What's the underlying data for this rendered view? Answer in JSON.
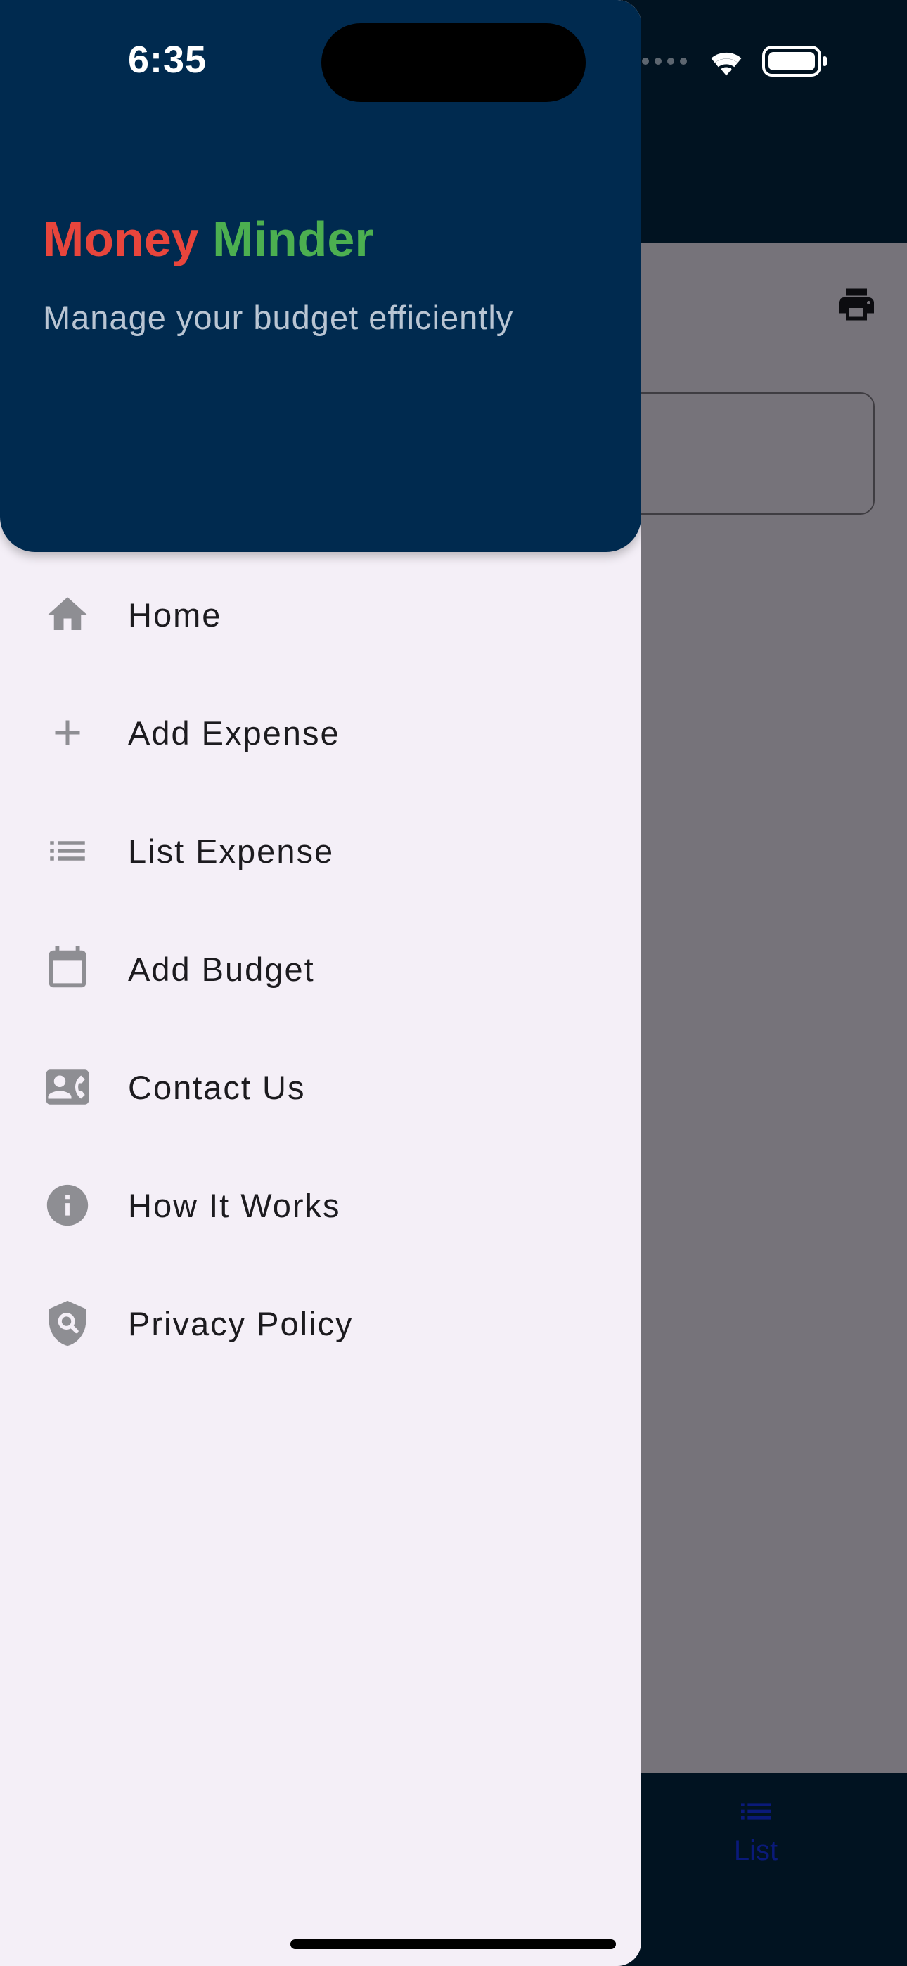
{
  "status_bar": {
    "time": "6:35"
  },
  "drawer": {
    "title_word_1": "Money",
    "title_word_2": "Minder",
    "subtitle": "Manage your budget efficiently",
    "items": [
      {
        "label": "Home",
        "icon": "home-icon"
      },
      {
        "label": "Add Expense",
        "icon": "plus-icon"
      },
      {
        "label": "List Expense",
        "icon": "list-icon"
      },
      {
        "label": "Add Budget",
        "icon": "calendar-icon"
      },
      {
        "label": "Contact Us",
        "icon": "contact-card-icon"
      },
      {
        "label": "How It Works",
        "icon": "info-icon"
      },
      {
        "label": "Privacy Policy",
        "icon": "privacy-shield-icon"
      }
    ]
  },
  "app": {
    "bottom_nav": {
      "list_label": "List"
    }
  },
  "colors": {
    "title_word_1": "#e8453c",
    "title_word_2": "#4caf50",
    "drawer_header_bg": "#002a4f",
    "drawer_bg": "#f4eff7",
    "icon_gray": "#8e8e93",
    "nav_selected": "#0a1a7a"
  }
}
